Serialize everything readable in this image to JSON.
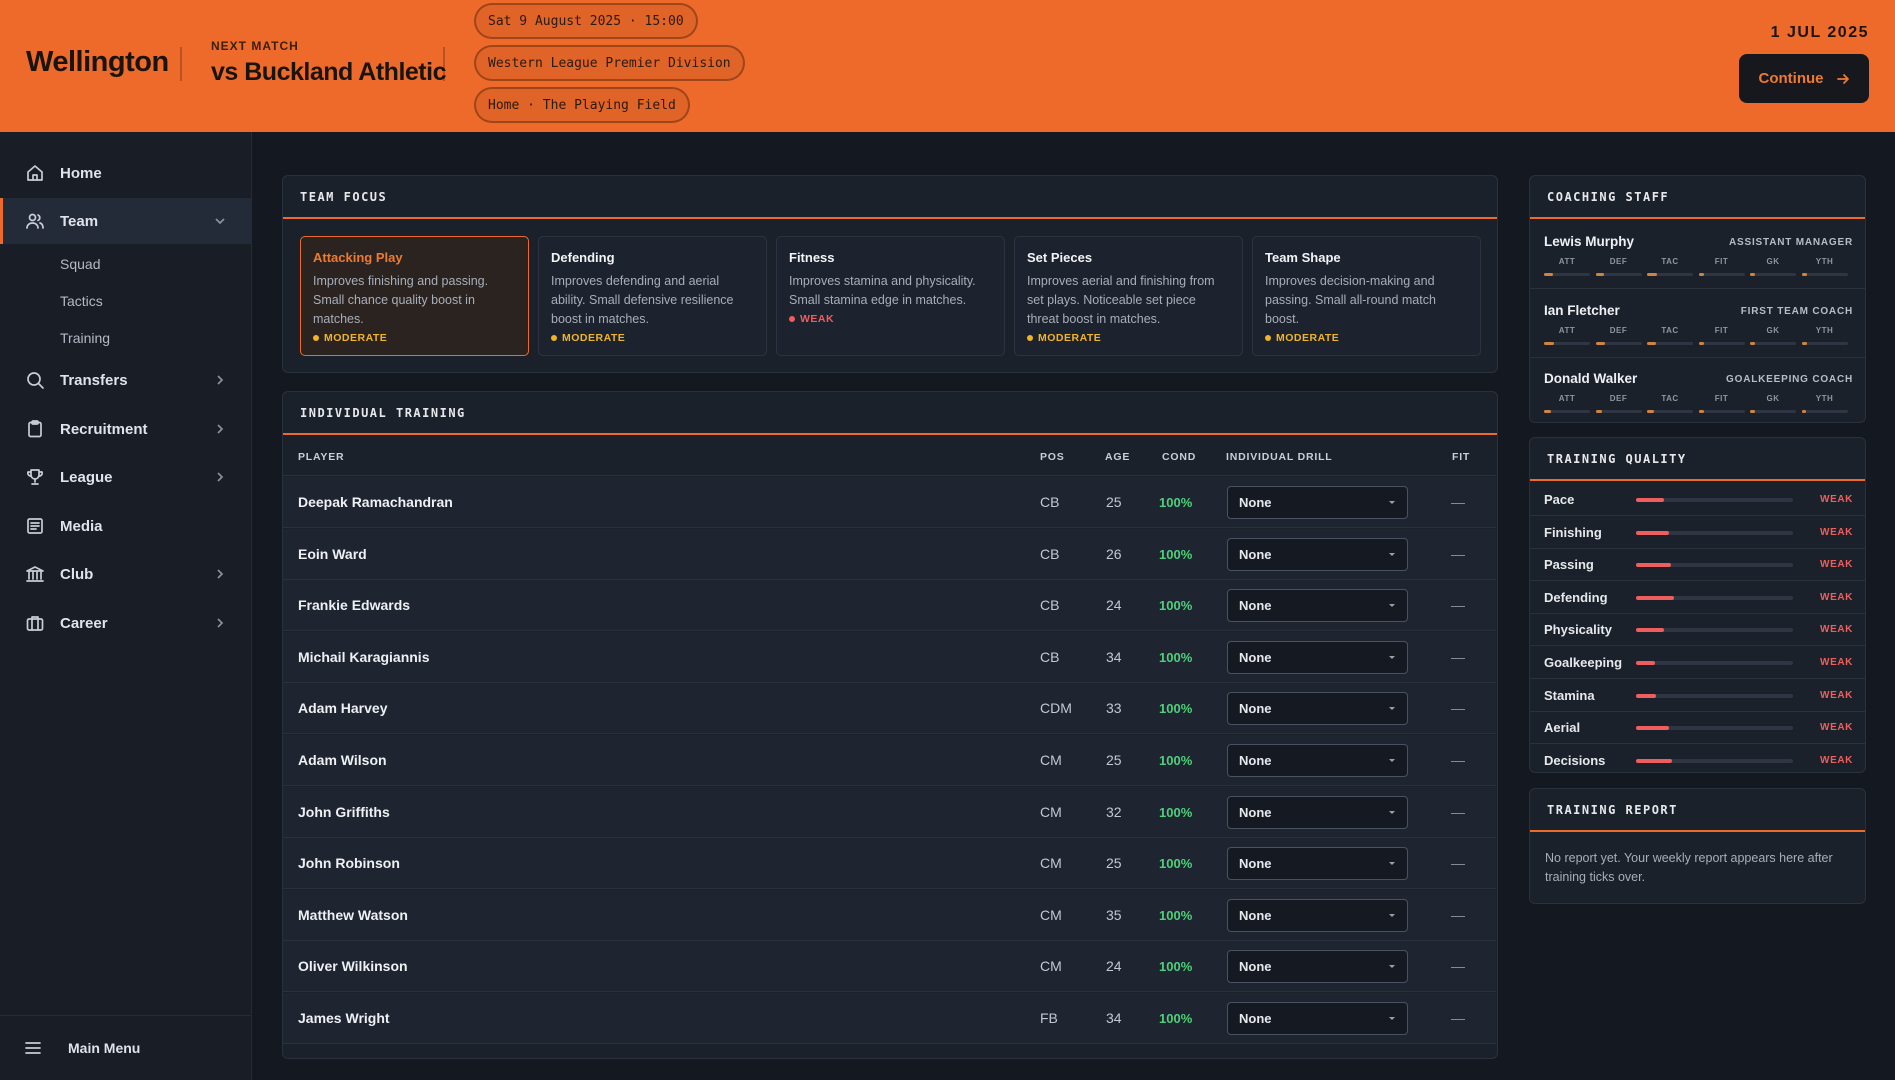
{
  "header": {
    "club_name": "Wellington",
    "next_label": "NEXT MATCH",
    "opponent": "vs Buckland Athletic",
    "pills": [
      "Sat 9 August 2025 · 15:00",
      "Western League Premier Division",
      "Home · The Playing Field"
    ],
    "date": "1 JUL 2025",
    "continue_label": "Continue"
  },
  "sidebar": {
    "items": [
      {
        "label": "Home",
        "icon": "home-icon"
      },
      {
        "label": "Team",
        "icon": "team-icon",
        "expanded": true
      },
      {
        "label": "Transfers",
        "icon": "search-icon"
      },
      {
        "label": "Recruitment",
        "icon": "clipboard-icon"
      },
      {
        "label": "League",
        "icon": "trophy-icon"
      },
      {
        "label": "Media",
        "icon": "newspaper-icon"
      },
      {
        "label": "Club",
        "icon": "bank-icon"
      },
      {
        "label": "Career",
        "icon": "briefcase-icon"
      }
    ],
    "team_sub": [
      "Squad",
      "Tactics",
      "Training"
    ],
    "main_menu": "Main Menu"
  },
  "team_focus": {
    "title": "TEAM FOCUS",
    "cards": [
      {
        "title": "Attacking Play",
        "desc": "Improves finishing and passing. Small chance quality boost in matches.",
        "strength": "MODERATE",
        "strength_color": "#f0b429",
        "selected": true
      },
      {
        "title": "Defending",
        "desc": "Improves defending and aerial ability. Small defensive resilience boost in matches.",
        "strength": "MODERATE",
        "strength_color": "#f0b429"
      },
      {
        "title": "Fitness",
        "desc": "Improves stamina and physicality. Small stamina edge in matches.",
        "strength": "WEAK",
        "strength_color": "#ef5d5d"
      },
      {
        "title": "Set Pieces",
        "desc": "Improves aerial and finishing from set plays. Noticeable set piece threat boost in matches.",
        "strength": "MODERATE",
        "strength_color": "#f0b429"
      },
      {
        "title": "Team Shape",
        "desc": "Improves decision-making and passing. Small all-round match boost.",
        "strength": "MODERATE",
        "strength_color": "#f0b429"
      }
    ]
  },
  "training": {
    "title": "INDIVIDUAL TRAINING",
    "columns": {
      "player": "PLAYER",
      "pos": "POS",
      "age": "AGE",
      "cond": "COND",
      "drill": "INDIVIDUAL DRILL",
      "fit": "FIT"
    },
    "rows": [
      {
        "name": "Deepak Ramachandran",
        "pos": "CB",
        "age": "25",
        "cond": "100%",
        "drill": "None",
        "fit": "—"
      },
      {
        "name": "Eoin Ward",
        "pos": "CB",
        "age": "26",
        "cond": "100%",
        "drill": "None",
        "fit": "—"
      },
      {
        "name": "Frankie Edwards",
        "pos": "CB",
        "age": "24",
        "cond": "100%",
        "drill": "None",
        "fit": "—"
      },
      {
        "name": "Michail Karagiannis",
        "pos": "CB",
        "age": "34",
        "cond": "100%",
        "drill": "None",
        "fit": "—"
      },
      {
        "name": "Adam Harvey",
        "pos": "CDM",
        "age": "33",
        "cond": "100%",
        "drill": "None",
        "fit": "—"
      },
      {
        "name": "Adam Wilson",
        "pos": "CM",
        "age": "25",
        "cond": "100%",
        "drill": "None",
        "fit": "—"
      },
      {
        "name": "John Griffiths",
        "pos": "CM",
        "age": "32",
        "cond": "100%",
        "drill": "None",
        "fit": "—"
      },
      {
        "name": "John Robinson",
        "pos": "CM",
        "age": "25",
        "cond": "100%",
        "drill": "None",
        "fit": "—"
      },
      {
        "name": "Matthew Watson",
        "pos": "CM",
        "age": "35",
        "cond": "100%",
        "drill": "None",
        "fit": "—"
      },
      {
        "name": "Oliver Wilkinson",
        "pos": "CM",
        "age": "24",
        "cond": "100%",
        "drill": "None",
        "fit": "—"
      },
      {
        "name": "James Wright",
        "pos": "FB",
        "age": "34",
        "cond": "100%",
        "drill": "None",
        "fit": "—"
      }
    ]
  },
  "coaching_staff": {
    "title": "COACHING STAFF",
    "attr_labels": [
      "ATT",
      "DEF",
      "TAC",
      "FIT",
      "GK",
      "YTH"
    ],
    "staff": [
      {
        "name": "Lewis Murphy",
        "role": "ASSISTANT MANAGER",
        "attrs": [
          0.2,
          0.18,
          0.22,
          0.12,
          0.1,
          0.12
        ]
      },
      {
        "name": "Ian Fletcher",
        "role": "FIRST TEAM COACH",
        "attrs": [
          0.22,
          0.2,
          0.2,
          0.12,
          0.1,
          0.12
        ]
      },
      {
        "name": "Donald Walker",
        "role": "GOALKEEPING COACH",
        "attrs": [
          0.15,
          0.15,
          0.15,
          0.12,
          0.1,
          0.1
        ]
      }
    ]
  },
  "training_quality": {
    "title": "TRAINING QUALITY",
    "rows": [
      {
        "name": "Pace",
        "level": 0.18,
        "label": "WEAK"
      },
      {
        "name": "Finishing",
        "level": 0.21,
        "label": "WEAK"
      },
      {
        "name": "Passing",
        "level": 0.22,
        "label": "WEAK"
      },
      {
        "name": "Defending",
        "level": 0.24,
        "label": "WEAK"
      },
      {
        "name": "Physicality",
        "level": 0.18,
        "label": "WEAK"
      },
      {
        "name": "Goalkeeping",
        "level": 0.12,
        "label": "WEAK"
      },
      {
        "name": "Stamina",
        "level": 0.13,
        "label": "WEAK"
      },
      {
        "name": "Aerial",
        "level": 0.21,
        "label": "WEAK"
      },
      {
        "name": "Decisions",
        "level": 0.23,
        "label": "WEAK"
      }
    ]
  },
  "training_report": {
    "title": "TRAINING REPORT",
    "text": "No report yet. Your weekly report appears here after training ticks over."
  }
}
